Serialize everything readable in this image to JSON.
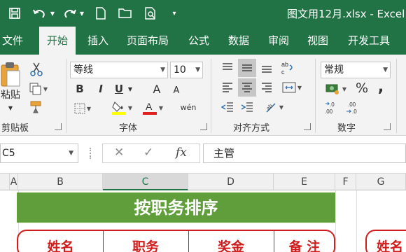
{
  "window": {
    "title": "图文用12月.xlsx  -  Excel"
  },
  "tabs": [
    "文件",
    "开始",
    "插入",
    "页面布局",
    "公式",
    "数据",
    "审阅",
    "视图",
    "开发工具"
  ],
  "ribbon": {
    "clipboard": {
      "paste_label": "粘贴",
      "group_label": "剪贴板"
    },
    "font": {
      "font_name": "等线",
      "font_size": "10",
      "group_label": "字体",
      "bold": "B",
      "italic": "I",
      "underline": "U",
      "grow": "A",
      "shrink": "A",
      "pinyin": "wén"
    },
    "alignment": {
      "group_label": "对齐方式"
    },
    "number": {
      "format": "常规",
      "group_label": "数字",
      "percent": "%",
      "comma": ","
    }
  },
  "formula_bar": {
    "name_box": "C5",
    "fx": "fx",
    "content": "主管"
  },
  "columns": [
    "A",
    "B",
    "C",
    "D",
    "E",
    "F",
    "G"
  ],
  "sheet": {
    "title": "按职务排序",
    "headers": [
      "姓名",
      "职务",
      "奖金",
      "备 注"
    ]
  },
  "colors": {
    "accent": "#217346",
    "banner": "#5f9e3a",
    "header_red": "#d11c1c"
  }
}
